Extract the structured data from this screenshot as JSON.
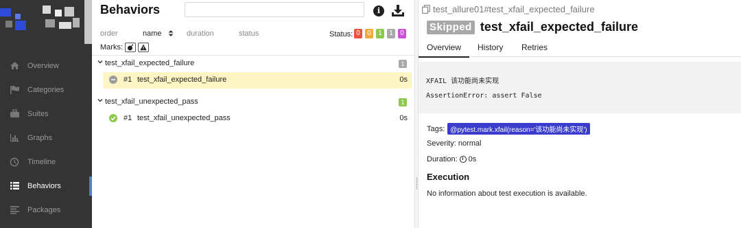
{
  "sidebar": {
    "items": [
      {
        "label": "Overview",
        "icon": "home-icon"
      },
      {
        "label": "Categories",
        "icon": "flag-icon"
      },
      {
        "label": "Suites",
        "icon": "briefcase-icon"
      },
      {
        "label": "Graphs",
        "icon": "bar-chart-icon"
      },
      {
        "label": "Timeline",
        "icon": "clock-icon"
      },
      {
        "label": "Behaviors",
        "icon": "list-icon",
        "active": true
      },
      {
        "label": "Packages",
        "icon": "align-left-icon"
      }
    ]
  },
  "tree": {
    "title": "Behaviors",
    "search_placeholder": "",
    "sort": {
      "order": "order",
      "name": "name",
      "duration": "duration",
      "status": "status"
    },
    "status_label": "Status:",
    "status_counts": [
      {
        "value": "0",
        "color": "#e8533e"
      },
      {
        "value": "0",
        "color": "#f0a93c"
      },
      {
        "value": "1",
        "color": "#8cc84b"
      },
      {
        "value": "1",
        "color": "#a8a8a8"
      },
      {
        "value": "0",
        "color": "#cc4fd6"
      }
    ],
    "marks_label": "Marks:",
    "groups": [
      {
        "name": "test_xfail_expected_failure",
        "count": "1",
        "count_color": "#a8a8a8",
        "case": {
          "order": "#1",
          "name": "test_xfail_expected_failure",
          "time": "0s"
        }
      },
      {
        "name": "test_xfail_unexpected_pass",
        "count": "1",
        "count_color": "#8cc84b",
        "case": {
          "order": "#1",
          "name": "test_xfail_unexpected_pass",
          "time": "0s"
        }
      }
    ]
  },
  "detail": {
    "breadcrumb": "test_allure01#test_xfail_expected_failure",
    "status_badge": "Skipped",
    "title": "test_xfail_expected_failure",
    "tabs": [
      "Overview",
      "History",
      "Retries"
    ],
    "trace_line1": "XFAIL 该功能尚未实现",
    "trace_line2": "AssertionError: assert False",
    "tags_label": "Tags:",
    "tag_value": "@pytest.mark.xfail(reason='该功能尚未实现')",
    "severity": "Severity: normal",
    "duration_label": "Duration:",
    "duration_value": "0s",
    "execution_title": "Execution",
    "execution_text": "No information about test execution is available."
  }
}
